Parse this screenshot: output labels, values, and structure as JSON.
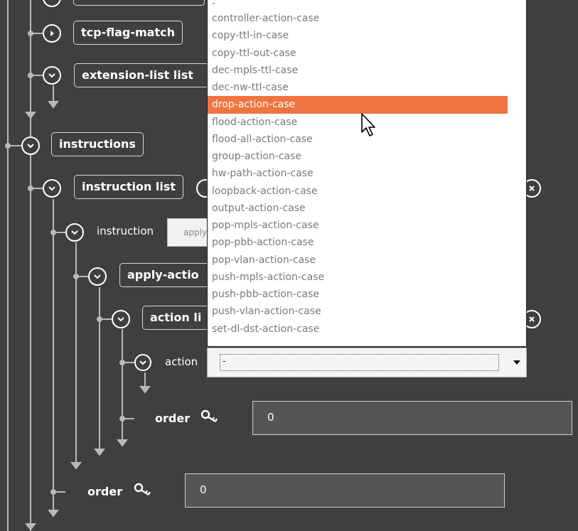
{
  "tree": {
    "tcp_flag_match": "tcp-flag-match",
    "extension_list": "extension-list list",
    "instructions": "instructions",
    "instruction_list": "instruction list",
    "instruction": "instruction",
    "instruction_value": "apply",
    "apply_actions": "apply-actio",
    "action_list": "action li",
    "action": "action",
    "inner_order_label": "order",
    "inner_order_value": "0",
    "outer_order_label": "order",
    "outer_order_value": "0"
  },
  "action_select": {
    "selected_value": "-",
    "options": [
      "-",
      "controller-action-case",
      "copy-ttl-in-case",
      "copy-ttl-out-case",
      "dec-mpls-ttl-case",
      "dec-nw-ttl-case",
      "drop-action-case",
      "flood-action-case",
      "flood-all-action-case",
      "group-action-case",
      "hw-path-action-case",
      "loopback-action-case",
      "output-action-case",
      "pop-mpls-action-case",
      "pop-pbb-action-case",
      "pop-vlan-action-case",
      "push-mpls-action-case",
      "push-pbb-action-case",
      "push-vlan-action-case",
      "set-dl-dst-action-case"
    ],
    "highlighted": "drop-action-case"
  },
  "icons": {
    "expand": "chevron-right-icon",
    "collapse": "chevron-down-icon",
    "key": "key-icon",
    "remove": "close-icon"
  },
  "colors": {
    "background": "#3f3f3f",
    "highlight": "#f07440"
  }
}
